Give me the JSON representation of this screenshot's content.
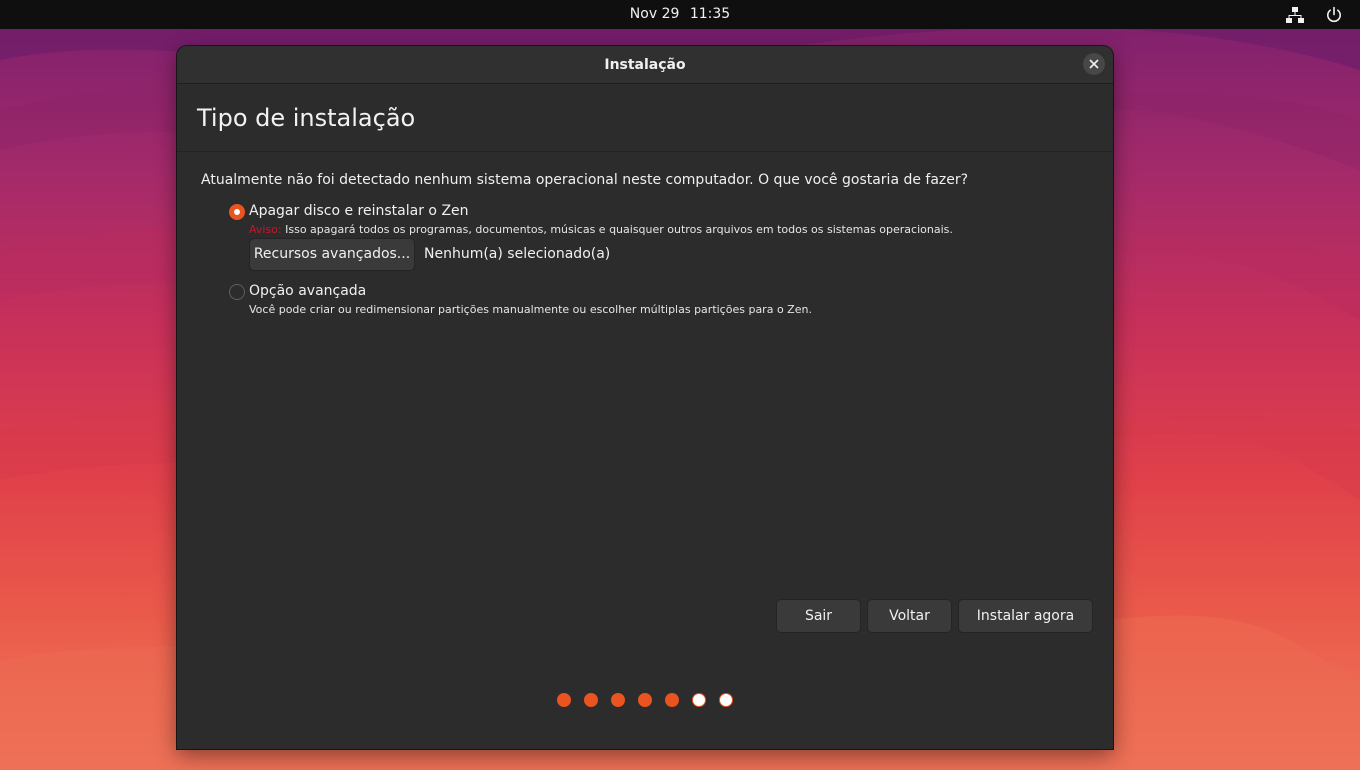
{
  "topbar": {
    "date": "Nov 29",
    "time": "11:35",
    "icons": [
      "network-icon",
      "power-icon"
    ]
  },
  "window": {
    "title": "Instalação",
    "heading": "Tipo de instalação",
    "question": "Atualmente não foi detectado nenhum sistema operacional neste computador. O que você gostaria de fazer?",
    "options": [
      {
        "label": "Apagar disco e reinstalar o Zen",
        "selected": true,
        "warning_prefix": "Aviso:",
        "description": " Isso apagará todos os programas, documentos, músicas e quaisquer outros arquivos em todos os sistemas operacionais."
      },
      {
        "label": "Opção avançada",
        "selected": false,
        "description": "Você pode criar ou redimensionar partições manualmente ou escolher múltiplas partições para o Zen."
      }
    ],
    "advanced_button": "Recursos avançados...",
    "advanced_status": "Nenhum(a) selecionado(a)",
    "buttons": {
      "quit": "Sair",
      "back": "Voltar",
      "install": "Instalar agora"
    },
    "progress": {
      "total_steps": 7,
      "completed_steps": 5
    }
  },
  "colors": {
    "accent": "#e95420",
    "warning": "#c7162b",
    "window_bg": "#2c2c2c",
    "topbar_bg": "#0f0f0f"
  }
}
